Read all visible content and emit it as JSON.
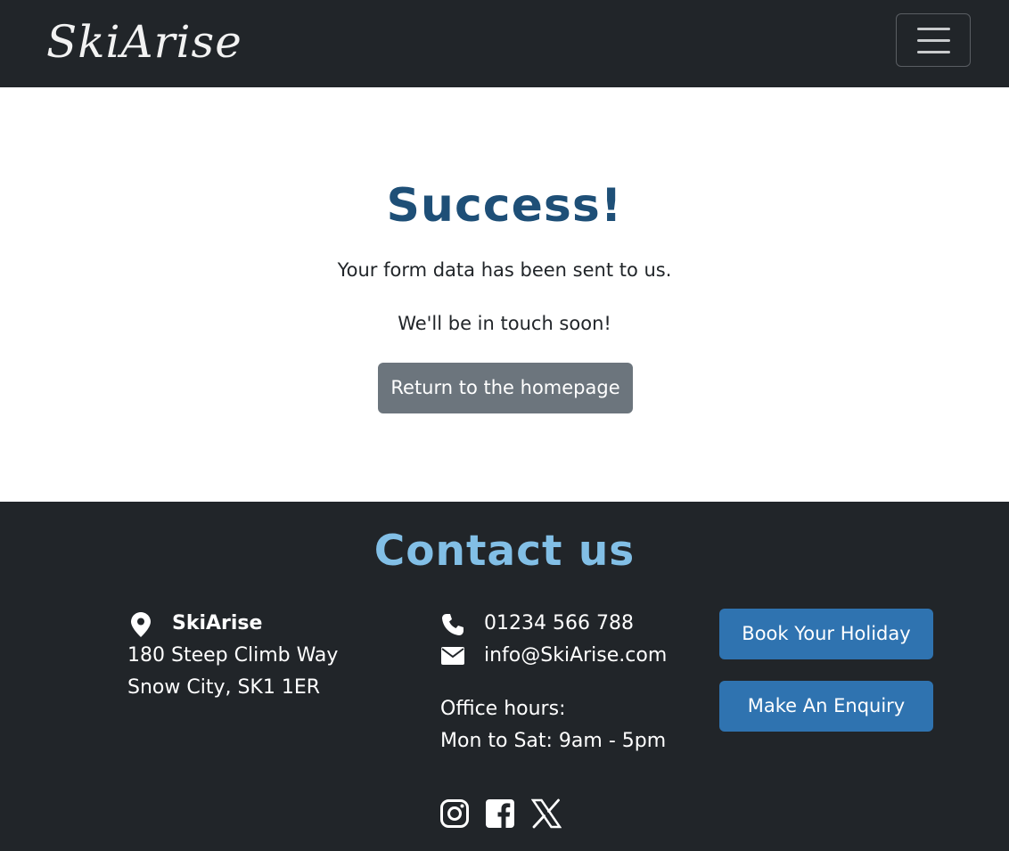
{
  "header": {
    "logo_text": "SkiArise",
    "menu_icon": "hamburger-menu-icon"
  },
  "main": {
    "title": "Success!",
    "message_1": "Your form data has been sent to us.",
    "message_2": "We'll be in touch soon!",
    "return_button": "Return to the homepage"
  },
  "footer": {
    "title": "Contact us",
    "address": {
      "icon": "location-pin-icon",
      "name": "SkiArise",
      "line1": "180 Steep Climb Way",
      "line2": "Snow City, SK1 1ER"
    },
    "phone": {
      "icon": "phone-icon",
      "text": "01234 566 788"
    },
    "email": {
      "icon": "envelope-icon",
      "text": "info@SkiArise.com"
    },
    "hours_label": "Office hours:",
    "hours_value": "Mon to Sat: 9am - 5pm",
    "buttons": {
      "book": "Book Your Holiday",
      "enquiry": "Make An Enquiry"
    },
    "social": [
      "instagram-icon",
      "facebook-icon",
      "x-icon"
    ]
  },
  "colors": {
    "dark": "#212529",
    "title_blue": "#1e4f77",
    "contact_blue": "#82bfe6",
    "button_blue": "#2f73b0",
    "button_gray": "#6c757d"
  }
}
